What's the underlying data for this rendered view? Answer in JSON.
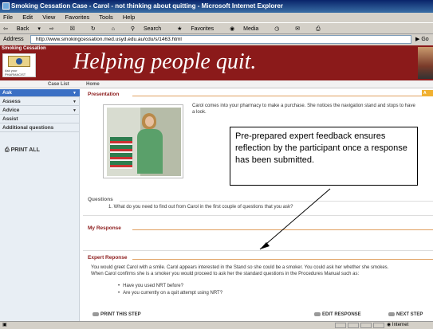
{
  "window": {
    "title": "Smoking Cessation Case - Carol - not thinking about quitting - Microsoft Internet Explorer"
  },
  "menu": [
    "File",
    "Edit",
    "View",
    "Favorites",
    "Tools",
    "Help"
  ],
  "toolbar": {
    "back": "Back",
    "search": "Search",
    "favorites": "Favorites",
    "media": "Media"
  },
  "address": {
    "label": "Address",
    "url": "http://www.smokingcessation.med.usyd.edu.au/cdu/s/1463.html",
    "go": "Go"
  },
  "banner": {
    "brand_tag": "Smoking Cessation",
    "logo_line1": "Ask your",
    "logo_line2": "PHARMACIST",
    "tagline": "Helping people quit."
  },
  "nav": {
    "case_list": "Case List",
    "home": "Home"
  },
  "sidebar": {
    "items": [
      {
        "label": "Ask",
        "active": true
      },
      {
        "label": "Assess",
        "active": false
      },
      {
        "label": "Advice",
        "active": false
      },
      {
        "label": "Assist",
        "active": false
      },
      {
        "label": "Additional questions",
        "active": false
      }
    ],
    "print_all": "PRINT ALL"
  },
  "main": {
    "presentation_label": "Presentation",
    "intro_line1": "Carol comes into your pharmacy to make a purchase. She notices the navigation stand and stops to have",
    "intro_line2": "a look.",
    "callout": "Pre-prepared expert feedback ensures reflection by the participant once a response has been submitted.",
    "questions_label": "Questions",
    "question": "1.   What do you need to find out from Carol in the first couple of questions that you ask?",
    "my_response_label": "My Response",
    "expert_label": "Expert Reponse",
    "expert_line1": "You would greet Carol with a smile. Carol appears interested in the Stand so she could be a smoker. You could ask her whether she smokes.",
    "expert_line2": "When Carol confirms she is a smoker you would proceed to ask her the standard questions in the Procedures Manual such as:",
    "bullets": [
      "Have you used NRT before?",
      "Are you currently on a quit attempt using NRT?"
    ],
    "print_step": "PRINT THIS STEP",
    "edit_response": "EDIT RESPONSE",
    "next_step": "NEXT STEP"
  },
  "status": {
    "zone": "Internet"
  }
}
